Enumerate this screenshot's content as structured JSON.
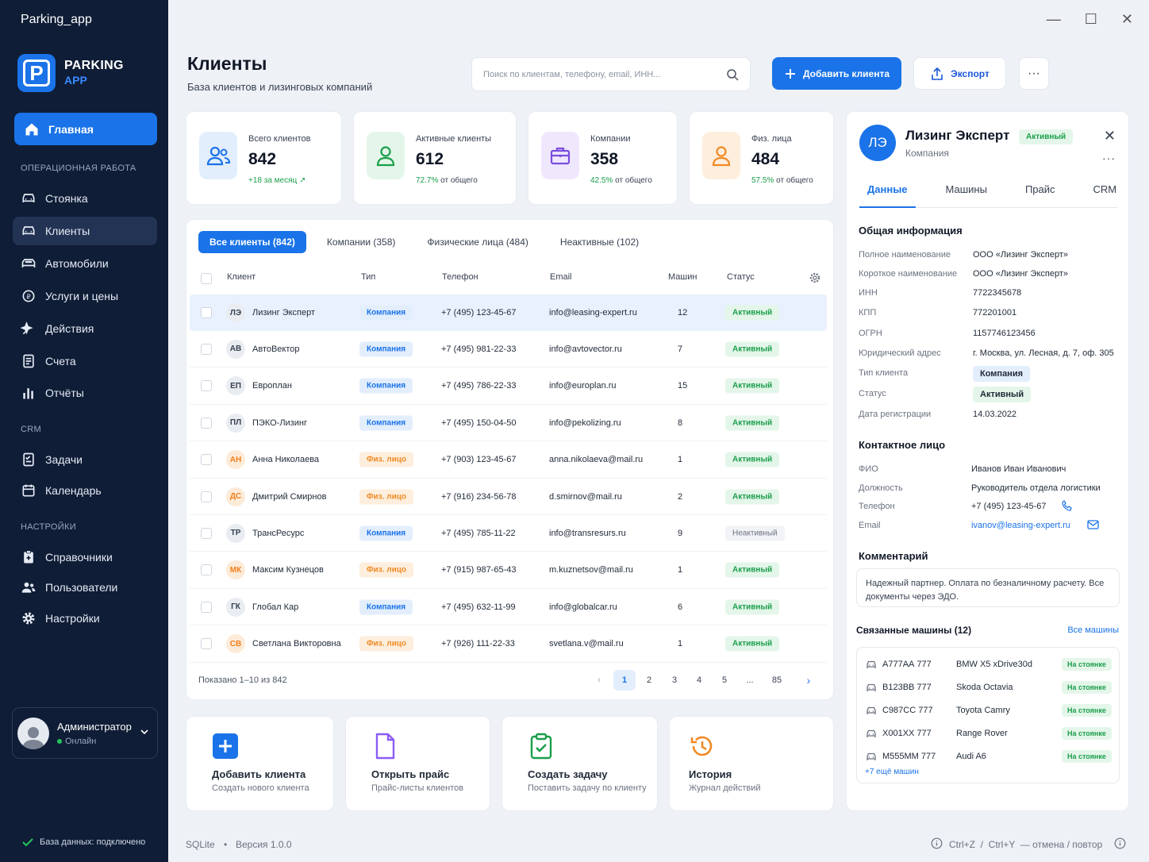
{
  "window": {
    "title": "Parking_app"
  },
  "brand": {
    "line1": "PARKING",
    "line2": "APP",
    "logo_letter": "P"
  },
  "nav": {
    "home": "Главная",
    "section_ops": "ОПЕРАЦИОННАЯ РАБОТА",
    "ops": [
      "Стоянка",
      "Клиенты",
      "Автомобили",
      "Услуги и цены",
      "Действия",
      "Счета",
      "Отчёты"
    ],
    "section_crm": "CRM",
    "crm": [
      "Задачи",
      "Календарь"
    ],
    "section_settings": "НАСТРОЙКИ",
    "settings": [
      "Справочники",
      "Пользователи",
      "Настройки"
    ]
  },
  "user": {
    "name": "Администратор",
    "status": "Онлайн"
  },
  "db_status": "База данных: подключено",
  "header": {
    "title": "Клиенты",
    "subtitle": "База клиентов и лизинговых компаний",
    "search_placeholder": "Поиск по клиентам, телефону, email, ИНН...",
    "add_button": "Добавить клиента",
    "export_button": "Экспорт",
    "more": "···"
  },
  "stats": [
    {
      "label": "Всего клиентов",
      "value": "842",
      "sub": "+18 за месяц",
      "accent": "#1a9e4b"
    },
    {
      "label": "Активные клиенты",
      "value": "612",
      "sub_value": "72.7%",
      "sub_rest": " от общего",
      "accent": "#1a9e4b"
    },
    {
      "label": "Компании",
      "value": "358",
      "sub_value": "42.5%",
      "sub_rest": " от общего",
      "accent": "#1a9e4b"
    },
    {
      "label": "Физ. лица",
      "value": "484",
      "sub_value": "57.5%",
      "sub_rest": " от общего",
      "accent": "#1a9e4b"
    }
  ],
  "tabs": [
    "Все клиенты (842)",
    "Компании (358)",
    "Физические лица (484)",
    "Неактивные (102)"
  ],
  "columns": {
    "client": "Клиент",
    "type": "Тип",
    "phone": "Телефон",
    "email": "Email",
    "cars": "Машин",
    "status": "Статус"
  },
  "rows": [
    {
      "initials": "ЛЭ",
      "name": "Лизинг Эксперт",
      "type": "Компания",
      "phone": "+7 (495) 123-45-67",
      "email": "info@leasing-expert.ru",
      "cars": "12",
      "status": "Активный"
    },
    {
      "initials": "АВ",
      "name": "АвтоВектор",
      "type": "Компания",
      "phone": "+7 (495) 981-22-33",
      "email": "info@avtovector.ru",
      "cars": "7",
      "status": "Активный"
    },
    {
      "initials": "ЕП",
      "name": "Европлан",
      "type": "Компания",
      "phone": "+7 (495) 786-22-33",
      "email": "info@europlan.ru",
      "cars": "15",
      "status": "Активный"
    },
    {
      "initials": "ПЛ",
      "name": "ПЭКО-Лизинг",
      "type": "Компания",
      "phone": "+7 (495) 150-04-50",
      "email": "info@pekolizing.ru",
      "cars": "8",
      "status": "Активный"
    },
    {
      "initials": "АН",
      "name": "Анна Николаева",
      "type": "Физ. лицо",
      "phone": "+7 (903) 123-45-67",
      "email": "anna.nikolaeva@mail.ru",
      "cars": "1",
      "status": "Активный"
    },
    {
      "initials": "ДС",
      "name": "Дмитрий Смирнов",
      "type": "Физ. лицо",
      "phone": "+7 (916) 234-56-78",
      "email": "d.smirnov@mail.ru",
      "cars": "2",
      "status": "Активный"
    },
    {
      "initials": "ТР",
      "name": "ТрансРесурс",
      "type": "Компания",
      "phone": "+7 (495) 785-11-22",
      "email": "info@transresurs.ru",
      "cars": "9",
      "status": "Неактивный"
    },
    {
      "initials": "МК",
      "name": "Максим Кузнецов",
      "type": "Физ. лицо",
      "phone": "+7 (915) 987-65-43",
      "email": "m.kuznetsov@mail.ru",
      "cars": "1",
      "status": "Активный"
    },
    {
      "initials": "ГК",
      "name": "Глобал Кар",
      "type": "Компания",
      "phone": "+7 (495) 632-11-99",
      "email": "info@globalcar.ru",
      "cars": "6",
      "status": "Активный"
    },
    {
      "initials": "СВ",
      "name": "Светлана Викторовна",
      "type": "Физ. лицо",
      "phone": "+7 (926) 111-22-33",
      "email": "svetlana.v@mail.ru",
      "cars": "1",
      "status": "Активный"
    }
  ],
  "pagination": {
    "info": "Показано 1–10 из 842",
    "pages": [
      "1",
      "2",
      "3",
      "4",
      "5",
      "...",
      "85"
    ],
    "current": "1"
  },
  "quick_actions": [
    {
      "title": "Добавить клиента",
      "sub": "Создать нового клиента"
    },
    {
      "title": "Открыть прайс",
      "sub": "Прайс-листы клиентов"
    },
    {
      "title": "Создать задачу",
      "sub": "Поставить задачу по клиенту"
    },
    {
      "title": "История",
      "sub": "Журнал действий"
    }
  ],
  "footer": {
    "db": "SQLite",
    "version": "Версия 1.0.0",
    "shortcuts": "Ctrl+Z  /  Ctrl+Y  — отмена / повтор"
  },
  "detail": {
    "initials": "ЛЭ",
    "name": "Лизинг Эксперт",
    "type": "Компания",
    "status": "Активный",
    "tabs": [
      "Данные",
      "Машины",
      "Прайс",
      "CRM"
    ],
    "general_title": "Общая информация",
    "general": [
      {
        "k": "Полное наименование",
        "v": "ООО «Лизинг Эксперт»"
      },
      {
        "k": "Короткое наименование",
        "v": "ООО «Лизинг Эксперт»"
      },
      {
        "k": "ИНН",
        "v": "7722345678"
      },
      {
        "k": "КПП",
        "v": "772201001"
      },
      {
        "k": "ОГРН",
        "v": "1157746123456"
      },
      {
        "k": "Юридический адрес",
        "v": "г. Москва, ул. Лесная, д. 7, оф. 305"
      },
      {
        "k": "Тип клиента",
        "v": "Компания"
      },
      {
        "k": "Статус",
        "v": "Активный"
      },
      {
        "k": "Дата регистрации",
        "v": "14.03.2022"
      }
    ],
    "contact_title": "Контактное лицо",
    "contact": [
      {
        "k": "ФИО",
        "v": "Иванов Иван Иванович"
      },
      {
        "k": "Должность",
        "v": "Руководитель отдела логистики"
      },
      {
        "k": "Телефон",
        "v": "+7 (495) 123-45-67"
      },
      {
        "k": "Email",
        "v": "ivanov@leasing-expert.ru"
      }
    ],
    "comment_title": "Комментарий",
    "comment": "Надежный партнер. Оплата по безналичному расчету. Все документы через ЭДО.",
    "cars_title": "Связанные машины (12)",
    "cars_all": "Все машины",
    "cars": [
      {
        "plate": "А777АА 777",
        "model": "BMW X5 xDrive30d",
        "status": "На стоянке"
      },
      {
        "plate": "В123ВВ 777",
        "model": "Skoda Octavia",
        "status": "На стоянке"
      },
      {
        "plate": "С987СС 777",
        "model": "Toyota Camry",
        "status": "На стоянке"
      },
      {
        "plate": "Х001ХХ 777",
        "model": "Range Rover",
        "status": "На стоянке"
      },
      {
        "plate": "М555ММ 777",
        "model": "Audi A6",
        "status": "На стоянке"
      }
    ],
    "cars_more": "+7 ещё машин"
  }
}
